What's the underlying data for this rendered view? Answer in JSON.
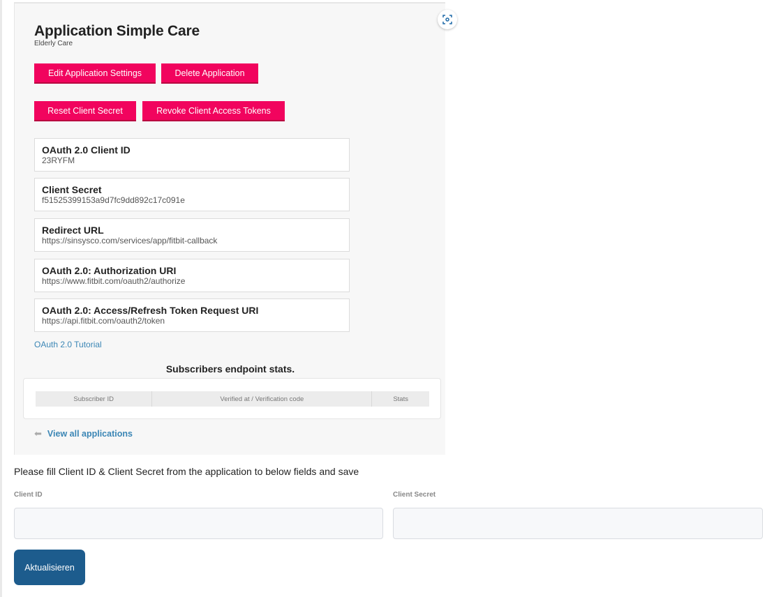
{
  "app": {
    "title": "Application Simple Care",
    "subtitle": "Elderly Care"
  },
  "actions": {
    "edit_settings": "Edit Application Settings",
    "delete_application": "Delete Application",
    "reset_client_secret": "Reset Client Secret",
    "revoke_tokens": "Revoke Client Access Tokens"
  },
  "details": [
    {
      "label": "OAuth 2.0 Client ID",
      "value": "23RYFM"
    },
    {
      "label": "Client Secret",
      "value": "f51525399153a9d7fc9dd892c17c091e"
    },
    {
      "label": "Redirect URL",
      "value": "https://sinsysco.com/services/app/fitbit-callback"
    },
    {
      "label": "OAuth 2.0: Authorization URI",
      "value": "https://www.fitbit.com/oauth2/authorize"
    },
    {
      "label": "OAuth 2.0: Access/Refresh Token Request URI",
      "value": "https://api.fitbit.com/oauth2/token"
    }
  ],
  "tutorial_link": "OAuth 2.0 Tutorial",
  "subscribers": {
    "title": "Subscribers endpoint stats.",
    "columns": [
      "Subscriber ID",
      "Verified at / Verification code",
      "Stats"
    ]
  },
  "view_all": "View all applications",
  "form": {
    "instructions": "Please fill Client ID & Client Secret from the application to below fields and save",
    "client_id_label": "Client ID",
    "client_id_value": "",
    "client_secret_label": "Client Secret",
    "client_secret_value": "",
    "save_label": "Aktualisieren"
  },
  "colors": {
    "pink_button": "#f1045e",
    "save_button": "#1d5c8d",
    "link": "#3b86b5"
  }
}
